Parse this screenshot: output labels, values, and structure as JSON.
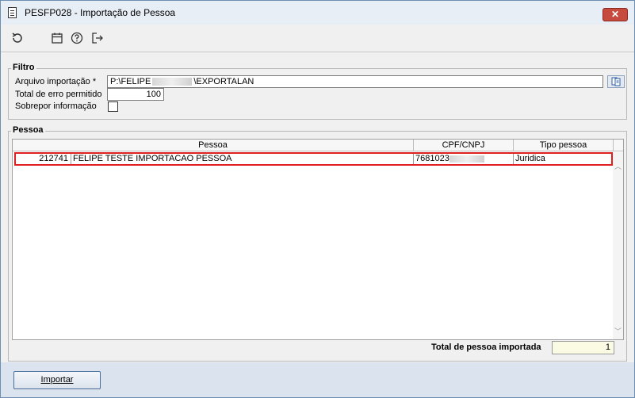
{
  "window": {
    "title": "PESFP028 - Importação de Pessoa",
    "close_label": "✕"
  },
  "toolbar": {
    "icons": [
      "refresh-icon",
      "calendar-icon",
      "help-icon",
      "exit-icon"
    ]
  },
  "filtro": {
    "title": "Filtro",
    "arquivo_label": "Arquivo importação *",
    "arquivo_value_prefix": "P:\\FELIPE",
    "arquivo_value_suffix": "\\EXPORTALAN",
    "total_erro_label": "Total de erro permitido",
    "total_erro_value": "100",
    "sobrepor_label": "Sobrepor informação"
  },
  "pessoa": {
    "title": "Pessoa",
    "columns": [
      "Pessoa",
      "CPF/CNPJ",
      "Tipo pessoa"
    ],
    "rows": [
      {
        "code": "212741",
        "name": "FELIPE TESTE IMPORTACAO PESSOA",
        "cpf_prefix": "7681023",
        "tipo": "Juridica"
      }
    ],
    "total_label": "Total de pessoa importada",
    "total_value": "1"
  },
  "footer": {
    "import_label": "Importar"
  }
}
